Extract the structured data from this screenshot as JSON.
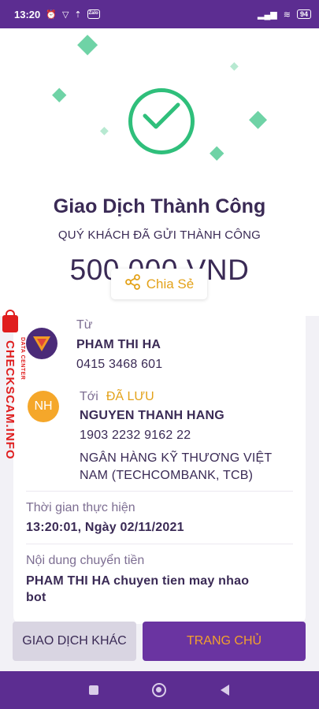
{
  "status_bar": {
    "time": "13:20",
    "battery": "94",
    "icons": [
      "alarm-icon",
      "vpn-icon",
      "upload-icon",
      "zalo-icon",
      "signal-icon",
      "wifi-icon",
      "battery-icon"
    ],
    "zalo_label": "Zalo"
  },
  "hero": {
    "title": "Giao Dịch Thành Công",
    "subtitle": "QUÝ KHÁCH ĐÃ GỬI THÀNH CÔNG",
    "amount": "500,000 VND",
    "share_label": "Chia Sẻ",
    "success_color": "#2fbf7b"
  },
  "sender": {
    "label": "Từ",
    "name": "PHAM THI HA",
    "account": "0415 3468 601"
  },
  "recipient": {
    "label": "Tới",
    "saved_tag": "ĐÃ LƯU",
    "initials": "NH",
    "name": "NGUYEN THANH HANG",
    "account": "1903 2232 9162 22",
    "bank_line1": "NGÂN HÀNG KỸ THƯƠNG VIỆT",
    "bank_line2": "NAM (TECHCOMBANK, TCB)"
  },
  "details": {
    "time_label": "Thời gian thực hiện",
    "time_value": "13:20:01, Ngày 02/11/2021",
    "content_label": "Nội dung chuyển tiền",
    "content_line1": "PHAM THI HA chuyen tien may nhao",
    "content_line2": "bot"
  },
  "actions": {
    "other_label": "GIAO DỊCH KHÁC",
    "home_label": "TRANG CHỦ"
  },
  "watermark": {
    "text": "CHECKSCAM.INFO",
    "sub": "DATA CENTER"
  },
  "colors": {
    "brand": "#5c2d91",
    "accent": "#e3a21a",
    "text": "#3a2a55"
  }
}
